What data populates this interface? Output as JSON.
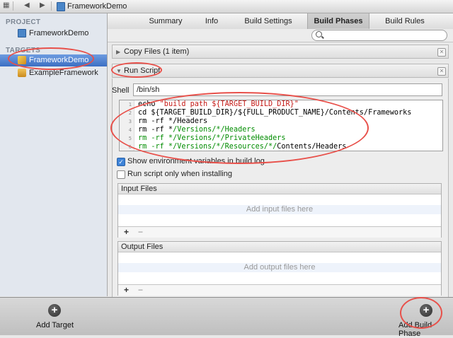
{
  "jumpbar": {
    "title": "FrameworkDemo"
  },
  "sidebar": {
    "project_header": "PROJECT",
    "project_item": "FrameworkDemo",
    "targets_header": "TARGETS",
    "targets": [
      "FrameworkDemo",
      "ExampleFramework"
    ]
  },
  "tabs": [
    "Summary",
    "Info",
    "Build Settings",
    "Build Phases",
    "Build Rules"
  ],
  "active_tab": "Build Phases",
  "phases": {
    "copy_files": "Copy Files (1 item)",
    "run_script": "Run Script"
  },
  "shell": {
    "label": "Shell",
    "value": "/bin/sh"
  },
  "script": {
    "line_numbers": [
      "1",
      "2",
      "3",
      "4",
      "5",
      "6"
    ],
    "line1_cmd": "echo ",
    "line1_str": "\"build path ${TARGET_BUILD_DIR}\"",
    "line2": "cd ${TARGET_BUILD_DIR}/${FULL_PRODUCT_NAME}/Contents/Frameworks",
    "line3": "rm -rf */Headers",
    "line4_a": "rm -rf *",
    "line4_b": "/Versions/*/Headers",
    "line5_a": "rm -rf *",
    "line5_b": "/Versions/*/PrivateHeaders",
    "line6_a": "rm -rf *",
    "line6_b": "/Versions/*/Resources/*/",
    "line6_c": "Contents/Headers"
  },
  "options": {
    "show_env": "Show environment variables in build log",
    "show_env_checked": true,
    "run_only_installing": "Run script only when installing",
    "run_only_installing_checked": false
  },
  "input_files": {
    "header": "Input Files",
    "placeholder": "Add input files here",
    "add": "+",
    "remove": "−"
  },
  "output_files": {
    "header": "Output Files",
    "placeholder": "Add output files here",
    "add": "+",
    "remove": "−"
  },
  "bottom": {
    "add_target": "Add Target",
    "add_build_phase": "Add Build Phase"
  },
  "colors": {
    "annotation": "#e8504a",
    "selection": "#3c6fc3"
  }
}
